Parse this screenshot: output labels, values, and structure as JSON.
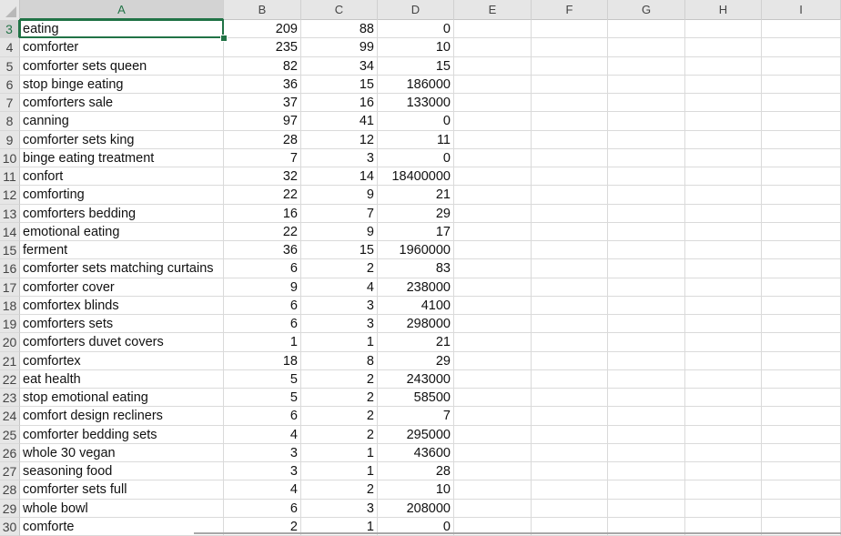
{
  "spreadsheet": {
    "columns": [
      "A",
      "B",
      "C",
      "D",
      "E",
      "F",
      "G",
      "H",
      "I"
    ],
    "active_column": "A",
    "active_row": 3,
    "selected_cell": "A3",
    "rows": [
      {
        "row": 3,
        "A": "eating",
        "B": 209,
        "C": 88,
        "D": 0
      },
      {
        "row": 4,
        "A": "comforter",
        "B": 235,
        "C": 99,
        "D": 10
      },
      {
        "row": 5,
        "A": "comforter sets queen",
        "B": 82,
        "C": 34,
        "D": 15
      },
      {
        "row": 6,
        "A": "stop binge eating",
        "B": 36,
        "C": 15,
        "D": 186000
      },
      {
        "row": 7,
        "A": "comforters sale",
        "B": 37,
        "C": 16,
        "D": 133000
      },
      {
        "row": 8,
        "A": "canning",
        "B": 97,
        "C": 41,
        "D": 0
      },
      {
        "row": 9,
        "A": "comforter sets king",
        "B": 28,
        "C": 12,
        "D": 11
      },
      {
        "row": 10,
        "A": "binge eating treatment",
        "B": 7,
        "C": 3,
        "D": 0
      },
      {
        "row": 11,
        "A": "confort",
        "B": 32,
        "C": 14,
        "D": 18400000
      },
      {
        "row": 12,
        "A": "comforting",
        "B": 22,
        "C": 9,
        "D": 21
      },
      {
        "row": 13,
        "A": "comforters bedding",
        "B": 16,
        "C": 7,
        "D": 29
      },
      {
        "row": 14,
        "A": "emotional eating",
        "B": 22,
        "C": 9,
        "D": 17
      },
      {
        "row": 15,
        "A": "ferment",
        "B": 36,
        "C": 15,
        "D": 1960000
      },
      {
        "row": 16,
        "A": "comforter sets matching curtains",
        "B": 6,
        "C": 2,
        "D": 83
      },
      {
        "row": 17,
        "A": "comforter cover",
        "B": 9,
        "C": 4,
        "D": 238000
      },
      {
        "row": 18,
        "A": "comfortex blinds",
        "B": 6,
        "C": 3,
        "D": 4100
      },
      {
        "row": 19,
        "A": "comforters sets",
        "B": 6,
        "C": 3,
        "D": 298000
      },
      {
        "row": 20,
        "A": "comforters duvet covers",
        "B": 1,
        "C": 1,
        "D": 21
      },
      {
        "row": 21,
        "A": "comfortex",
        "B": 18,
        "C": 8,
        "D": 29
      },
      {
        "row": 22,
        "A": "eat health",
        "B": 5,
        "C": 2,
        "D": 243000
      },
      {
        "row": 23,
        "A": "stop emotional eating",
        "B": 5,
        "C": 2,
        "D": 58500
      },
      {
        "row": 24,
        "A": "comfort design recliners",
        "B": 6,
        "C": 2,
        "D": 7
      },
      {
        "row": 25,
        "A": "comforter bedding sets",
        "B": 4,
        "C": 2,
        "D": 295000
      },
      {
        "row": 26,
        "A": "whole 30 vegan",
        "B": 3,
        "C": 1,
        "D": 43600
      },
      {
        "row": 27,
        "A": "seasoning food",
        "B": 3,
        "C": 1,
        "D": 28
      },
      {
        "row": 28,
        "A": "comforter sets full",
        "B": 4,
        "C": 2,
        "D": 10
      },
      {
        "row": 29,
        "A": "whole bowl",
        "B": 6,
        "C": 3,
        "D": 208000
      },
      {
        "row": 30,
        "A": "comforte",
        "B": 2,
        "C": 1,
        "D": 0
      }
    ]
  },
  "colors": {
    "accent": "#217346",
    "header_bg": "#e6e6e6",
    "gridline": "#dadada"
  }
}
